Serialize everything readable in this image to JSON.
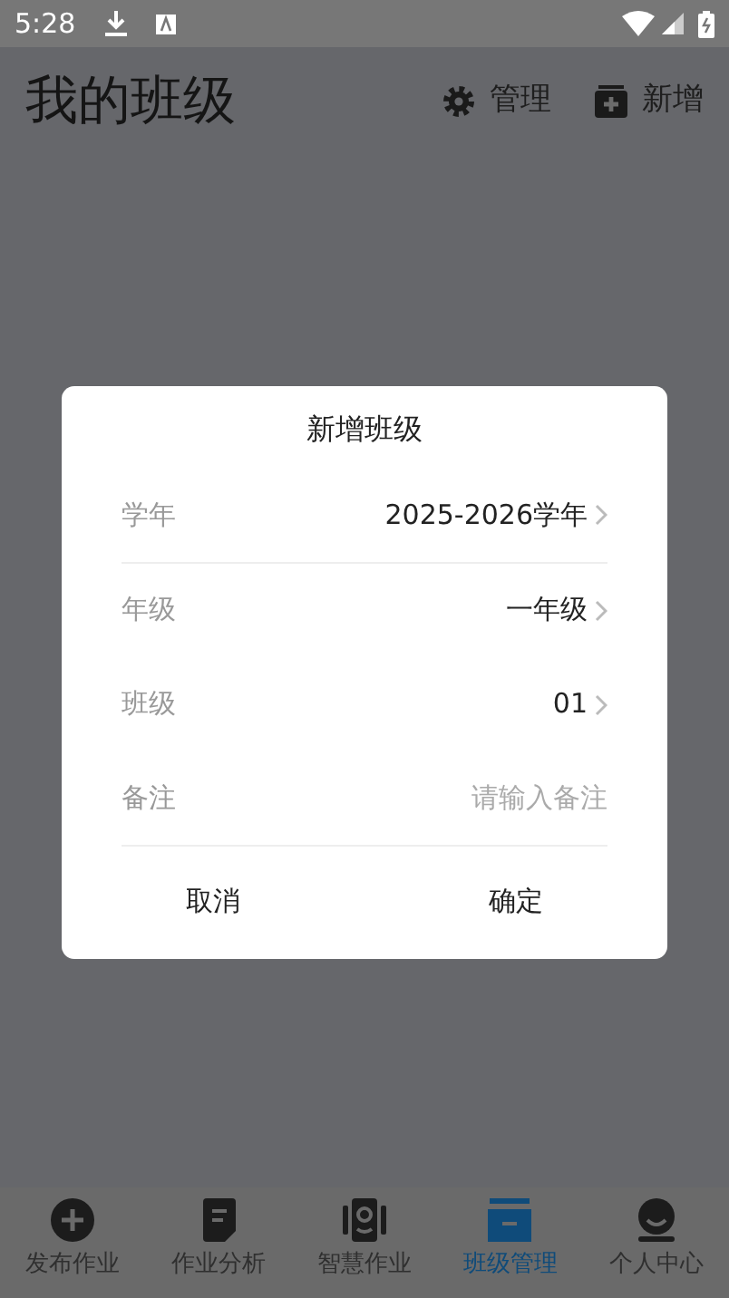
{
  "status_bar": {
    "time": "5:28"
  },
  "header": {
    "title": "我的班级",
    "actions": [
      {
        "kind": "gear",
        "label": "管理"
      },
      {
        "kind": "add",
        "label": "新增"
      }
    ]
  },
  "dialog": {
    "title": "新增班级",
    "rows": [
      {
        "kind": "picker",
        "label": "学年",
        "value": "2025-2026学年",
        "divider": true
      },
      {
        "kind": "picker",
        "label": "年级",
        "value": "一年级",
        "divider": false
      },
      {
        "kind": "picker",
        "label": "班级",
        "value": "01",
        "divider": false
      },
      {
        "kind": "input",
        "label": "备注",
        "placeholder": "请输入备注",
        "divider": true
      }
    ],
    "buttons": [
      "取消",
      "确定"
    ]
  },
  "tabs": [
    {
      "kind": "plus",
      "label": "发布作业",
      "selected": false
    },
    {
      "kind": "doc",
      "label": "作业分析",
      "selected": false
    },
    {
      "kind": "camera",
      "label": "智慧作业",
      "selected": false
    },
    {
      "kind": "box",
      "label": "班级管理",
      "selected": true
    },
    {
      "kind": "person",
      "label": "个人中心",
      "selected": false
    }
  ]
}
